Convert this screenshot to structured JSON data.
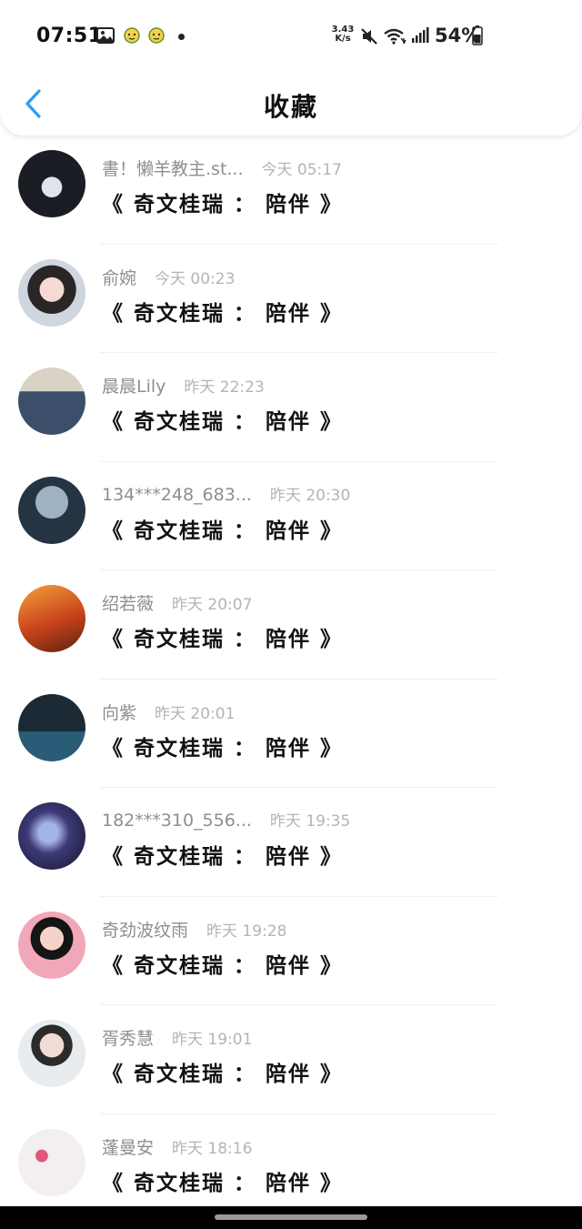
{
  "status_bar": {
    "time": "07:51",
    "net_speed_value": "3.43",
    "net_speed_unit": "K/s",
    "battery": "54%",
    "icons": [
      "gallery-icon",
      "emoji-icon",
      "emoji-icon",
      "dot-icon",
      "mute-icon",
      "wifi-icon",
      "signal-icon",
      "battery-icon"
    ]
  },
  "header": {
    "title": "收藏",
    "back_icon": "chevron-left-icon",
    "accent_color": "#2d9cf0"
  },
  "items": [
    {
      "name": "書！懒羊教主.st...",
      "time": "今天 05:17",
      "title": "《 奇文桂瑞 ： 陪伴 》"
    },
    {
      "name": "俞婉",
      "time": "今天 00:23",
      "title": "《 奇文桂瑞 ： 陪伴 》"
    },
    {
      "name": "晨晨Lily",
      "time": "昨天 22:23",
      "title": "《 奇文桂瑞 ： 陪伴 》"
    },
    {
      "name": "134***248_683...",
      "time": "昨天 20:30",
      "title": "《 奇文桂瑞 ： 陪伴 》"
    },
    {
      "name": "绍若薇",
      "time": "昨天 20:07",
      "title": "《 奇文桂瑞 ： 陪伴 》"
    },
    {
      "name": "向紫",
      "time": "昨天 20:01",
      "title": "《 奇文桂瑞 ： 陪伴 》"
    },
    {
      "name": "182***310_556...",
      "time": "昨天 19:35",
      "title": "《 奇文桂瑞 ： 陪伴 》"
    },
    {
      "name": "奇劲波纹雨",
      "time": "昨天 19:28",
      "title": "《 奇文桂瑞 ： 陪伴 》"
    },
    {
      "name": "胥秀慧",
      "time": "昨天 19:01",
      "title": "《 奇文桂瑞 ： 陪伴 》"
    },
    {
      "name": "蓬曼安",
      "time": "昨天 18:16",
      "title": "《 奇文桂瑞 ： 陪伴 》"
    }
  ]
}
